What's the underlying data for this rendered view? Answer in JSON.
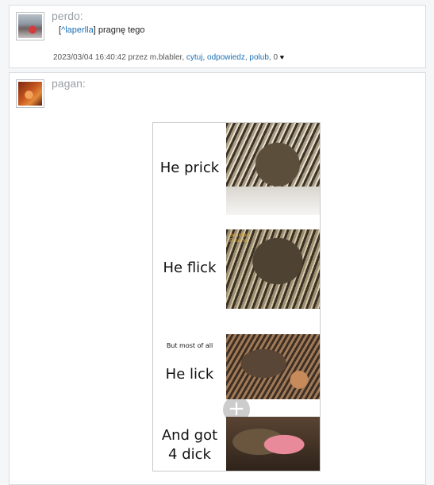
{
  "comments": [
    {
      "author": "perdo:",
      "reply_to_open": "[",
      "reply_to_link": "^laperlla",
      "reply_to_close": "]",
      "text": " pragnę tego",
      "meta": {
        "date": "2023/03/04 16:40:42 przez m.blabler,",
        "cytuj": "cytuj",
        "odpowiedz": "odpowiedz",
        "polub": "polub",
        "likes": "0",
        "heart_icon": "heart-icon"
      }
    },
    {
      "author": "pagan:",
      "image": {
        "panels": [
          {
            "caption": "He prick"
          },
          {
            "caption": "He flick",
            "watermark": "Bearded\nEchidna\n..."
          },
          {
            "subcaption": "But most of all",
            "caption": "He lick"
          },
          {
            "caption": "And got\n4 dick"
          }
        ],
        "zoom_icon": "plus-icon",
        "zoom_label": "+"
      }
    }
  ]
}
